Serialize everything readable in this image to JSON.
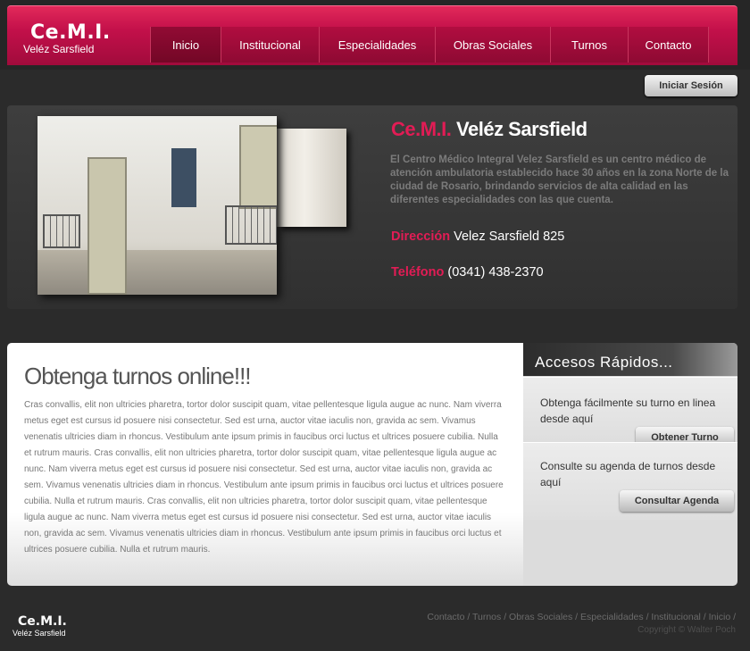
{
  "header": {
    "logo_line1": "Ce.M.I.",
    "logo_line2": "Veléz Sarsfield",
    "nav": [
      {
        "label": "Inicio",
        "active": true
      },
      {
        "label": "Institucional"
      },
      {
        "label": "Especialidades"
      },
      {
        "label": "Obras Sociales"
      },
      {
        "label": "Turnos"
      },
      {
        "label": "Contacto"
      }
    ]
  },
  "login": {
    "label": "Iniciar Sesión"
  },
  "feature": {
    "title_pink": "Ce.M.I.",
    "title_white": "Veléz Sarsfield",
    "description": "El Centro Médico Integral Velez Sarsfield es un centro médico de atención ambulatoria establecido hace 30 años en la zona Norte de la ciudad de Rosario, brindando servicios de alta calidad en las diferentes especialidades con las que cuenta.",
    "address_label": "Dirección",
    "address_value": "Velez Sarsfield 825",
    "phone_label": "Teléfono",
    "phone_value": "(0341) 438-2370"
  },
  "content": {
    "title": "Obtenga turnos online!!!",
    "body": "Cras convallis, elit non ultricies pharetra, tortor dolor suscipit quam, vitae pellentesque ligula augue ac nunc. Nam viverra metus eget est cursus id posuere nisi consectetur. Sed est urna, auctor vitae iaculis non, gravida ac sem. Vivamus venenatis ultricies diam in rhoncus. Vestibulum ante ipsum primis in faucibus orci luctus et ultrices posuere cubilia. Nulla et rutrum mauris. Cras convallis, elit non ultricies pharetra, tortor dolor suscipit quam, vitae pellentesque ligula augue ac nunc. Nam viverra metus eget est cursus id posuere nisi consectetur. Sed est urna, auctor vitae iaculis non, gravida ac sem. Vivamus venenatis ultricies diam in rhoncus. Vestibulum ante ipsum primis in faucibus orci luctus et ultrices posuere cubilia. Nulla et rutrum mauris. Cras convallis, elit non ultricies pharetra, tortor dolor suscipit quam, vitae pellentesque ligula augue ac nunc. Nam viverra metus eget est cursus id posuere nisi consectetur. Sed est urna, auctor vitae iaculis non, gravida ac sem. Vivamus venenatis ultricies diam in rhoncus. Vestibulum ante ipsum primis in faucibus orci luctus et ultrices posuere cubilia. Nulla et rutrum mauris."
  },
  "sidebar": {
    "title": "Accesos  Rápidos...",
    "box1_text": "Obtenga fácilmente su turno en linea desde aquí",
    "box1_button": "Obtener Turno",
    "box2_text": "Consulte su agenda de turnos desde aquí",
    "box2_button": "Consultar Agenda"
  },
  "footer": {
    "logo_line1": "Ce.M.I.",
    "logo_line2": "Veléz Sarsfield",
    "links": [
      "Contacto",
      "Turnos",
      "Obras Sociales",
      "Especialidades",
      "Institucional",
      "Inicio"
    ],
    "copyright": "Copyright © Walter Poch"
  },
  "colors": {
    "brand_pink": "#e21c55",
    "header_red": "#c3104a"
  }
}
